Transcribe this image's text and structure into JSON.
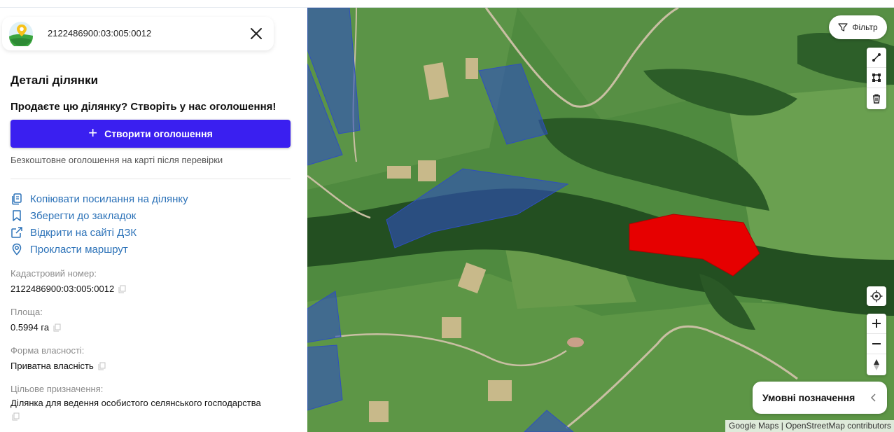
{
  "search": {
    "value": "2122486900:03:005:0012"
  },
  "details": {
    "title": "Деталі ділянки",
    "sell_prompt": "Продаєте цю ділянку? Створіть у нас оголошення!",
    "create_button": "Створити оголошення",
    "free_note": "Безкоштовне оголошення на карті після перевірки"
  },
  "actions": [
    {
      "label": "Копіювати посилання на ділянку",
      "icon": "copy-icon"
    },
    {
      "label": "Зберегти до закладок",
      "icon": "bookmark-icon"
    },
    {
      "label": "Відкрити на сайті ДЗК",
      "icon": "external-link-icon"
    },
    {
      "label": "Прокласти маршрут",
      "icon": "location-pin-icon"
    }
  ],
  "fields": [
    {
      "label": "Кадастровий номер:",
      "value": "2122486900:03:005:0012"
    },
    {
      "label": "Площа:",
      "value": "0.5994 га"
    },
    {
      "label": "Форма власності:",
      "value": "Приватна власність"
    },
    {
      "label": "Цільове призначення:",
      "value": "Ділянка для ведення особистого селянського господарства"
    }
  ],
  "map": {
    "filter_label": "Фільтр",
    "legend_label": "Умовні позначення",
    "attribution": "Google Maps | OpenStreetMap contributors",
    "selected_parcel_color": "#e60000",
    "other_parcels_color": "#2f4fbf"
  }
}
